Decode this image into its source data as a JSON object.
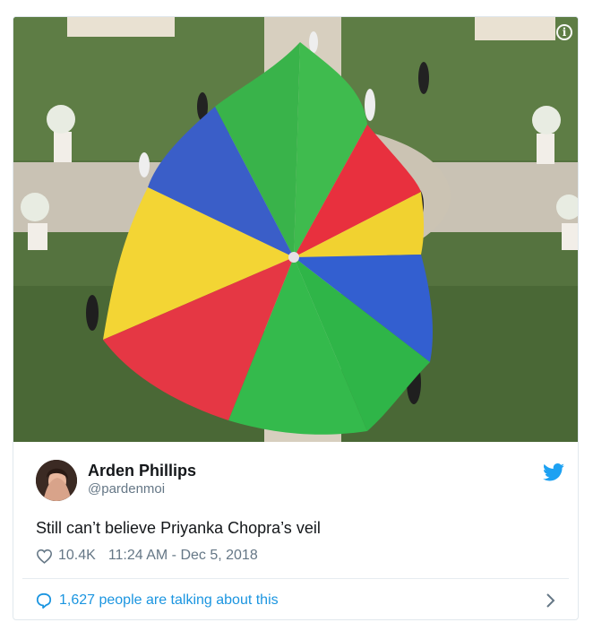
{
  "tweet": {
    "author_name": "Arden Phillips",
    "author_handle": "@pardenmoi",
    "text": "Still can’t believe Priyanka Chopra’s veil",
    "likes": "10.4K",
    "timestamp": "11:24 AM - Dec 5, 2018",
    "conversation": "1,627 people are talking about this"
  },
  "icons": {
    "info": "info-icon",
    "twitter": "twitter-bird-icon",
    "like": "heart-icon",
    "reply": "speech-bubble-icon",
    "more": "chevron-right-icon"
  },
  "colors": {
    "link_blue": "#1b95e0",
    "text_dark": "#14171a",
    "text_gray": "#657786",
    "border": "#e1e8ed"
  }
}
